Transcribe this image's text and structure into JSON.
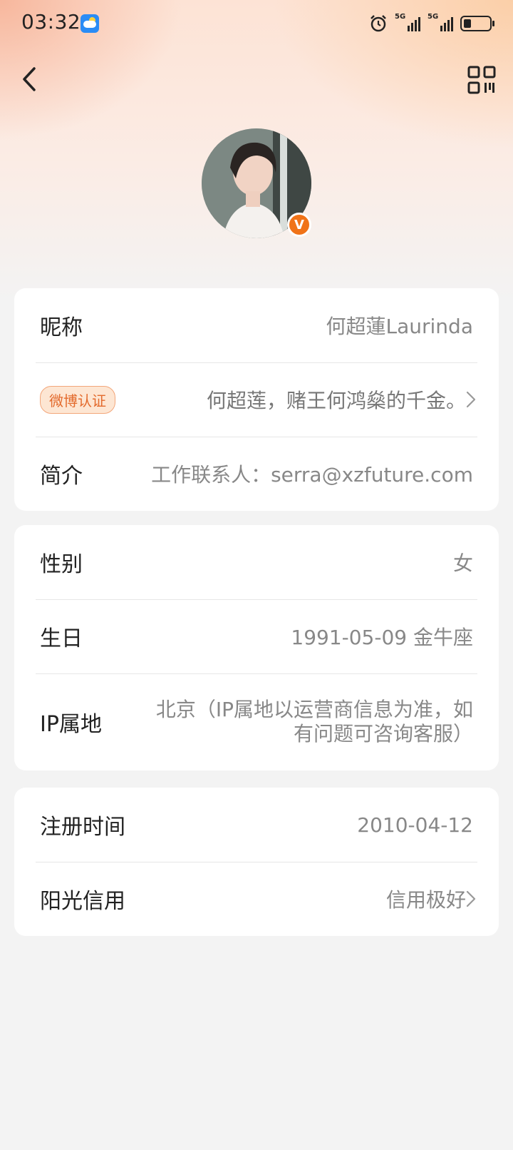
{
  "status_bar": {
    "time": "03:32",
    "weather_icon": "weather-app-icon",
    "alarm_icon": "alarm-icon",
    "signal1_label": "5G",
    "signal2_label": "5G",
    "battery_icon": "battery-icon"
  },
  "header": {
    "back_icon": "chevron-left-icon",
    "qr_icon": "qr-code-icon"
  },
  "profile": {
    "avatar_alt": "avatar",
    "verified_badge": "V"
  },
  "card1": {
    "nickname_label": "昵称",
    "nickname_value": "何超蓮Laurinda",
    "verify_badge": "微博认证",
    "verify_value": "何超莲，赌王何鸿燊的千金。",
    "bio_label": "简介",
    "bio_value": "工作联系人：serra@xzfuture.com"
  },
  "card2": {
    "gender_label": "性别",
    "gender_value": "女",
    "birthday_label": "生日",
    "birthday_value": "1991-05-09 金牛座",
    "ip_label": "IP属地",
    "ip_value": "北京（IP属地以运营商信息为准，如有问题可咨询客服）"
  },
  "card3": {
    "register_label": "注册时间",
    "register_value": "2010-04-12",
    "credit_label": "阳光信用",
    "credit_value": "信用极好"
  },
  "colors": {
    "accent_orange": "#f07318",
    "page_bg": "#f3f3f3",
    "value_gray": "#888888"
  }
}
